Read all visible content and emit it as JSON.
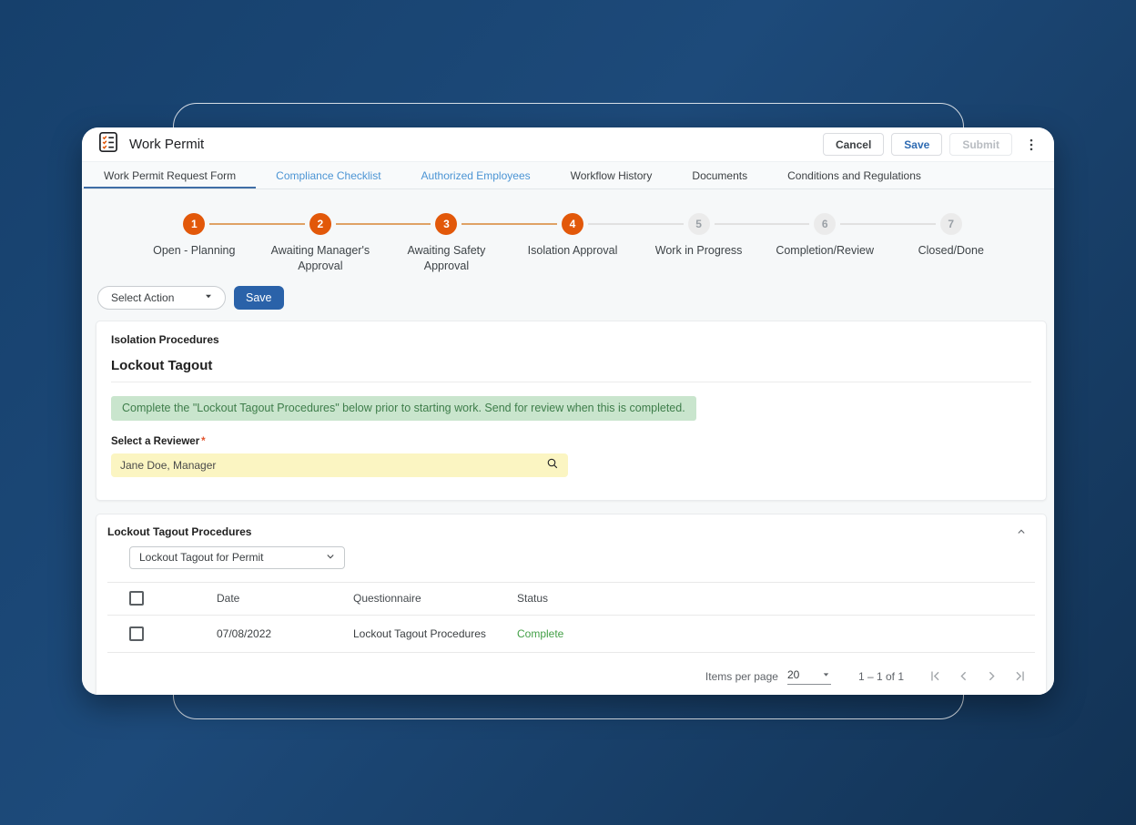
{
  "window": {
    "title": "Work Permit",
    "header_buttons": {
      "cancel": "Cancel",
      "save": "Save",
      "submit": "Submit"
    }
  },
  "tabs": [
    {
      "label": "Work Permit Request Form"
    },
    {
      "label": "Compliance Checklist"
    },
    {
      "label": "Authorized Employees"
    },
    {
      "label": "Workflow History"
    },
    {
      "label": "Documents"
    },
    {
      "label": "Conditions and Regulations"
    }
  ],
  "stepper": {
    "steps": [
      {
        "num": "1",
        "label": "Open - Planning"
      },
      {
        "num": "2",
        "label": "Awaiting Manager's Approval"
      },
      {
        "num": "3",
        "label": "Awaiting Safety Approval"
      },
      {
        "num": "4",
        "label": "Isolation Approval"
      },
      {
        "num": "5",
        "label": "Work in Progress"
      },
      {
        "num": "6",
        "label": "Completion/Review"
      },
      {
        "num": "7",
        "label": "Closed/Done"
      }
    ]
  },
  "action_bar": {
    "select_action_label": "Select Action",
    "save_label": "Save"
  },
  "isolation_card": {
    "section_label": "Isolation Procedures",
    "title": "Lockout Tagout",
    "notice": "Complete the \"Lockout Tagout Procedures\" below prior to starting work. Send for review when this is completed.",
    "reviewer_label": "Select a Reviewer",
    "required_marker": "*",
    "reviewer_value": "Jane Doe, Manager"
  },
  "procedures_card": {
    "title": "Lockout Tagout Procedures",
    "select_value": "Lockout Tagout for Permit",
    "table": {
      "headers": {
        "date": "Date",
        "questionnaire": "Questionnaire",
        "status": "Status"
      },
      "rows": [
        {
          "date": "07/08/2022",
          "questionnaire": "Lockout Tagout Procedures",
          "status": "Complete"
        }
      ]
    },
    "pagination": {
      "items_per_page_label": "Items per page",
      "page_size": "20",
      "range": "1 – 1 of 1"
    }
  },
  "colors": {
    "accent_orange": "#e2580a",
    "connector_orange": "#dfa265",
    "link_blue": "#4b94d4",
    "primary_blue": "#2a62a9",
    "success_green": "#43a047",
    "notice_bg": "#c9e5cd",
    "notice_text": "#3e7d4a",
    "highlight_yellow": "#fbf5c2",
    "background_navy": "#1d4a7a"
  }
}
